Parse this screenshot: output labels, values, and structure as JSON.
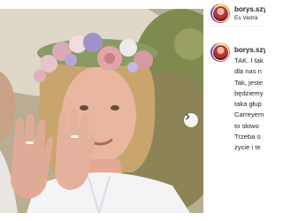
{
  "post": {
    "username": "borys.szyc",
    "location": "Es Vedrà",
    "caption_lines": [
      "TAK. I tak",
      "dla nas n",
      "Tak, jeste",
      "będziemy",
      "taka głup",
      "Carreyem",
      "to słowo",
      "Trzeba o",
      "życie i te"
    ]
  },
  "icons": {
    "next_arrow": "chevron-right-icon"
  },
  "colors": {
    "text": "#262626",
    "divider": "#efefef",
    "background": "#ffffff"
  }
}
